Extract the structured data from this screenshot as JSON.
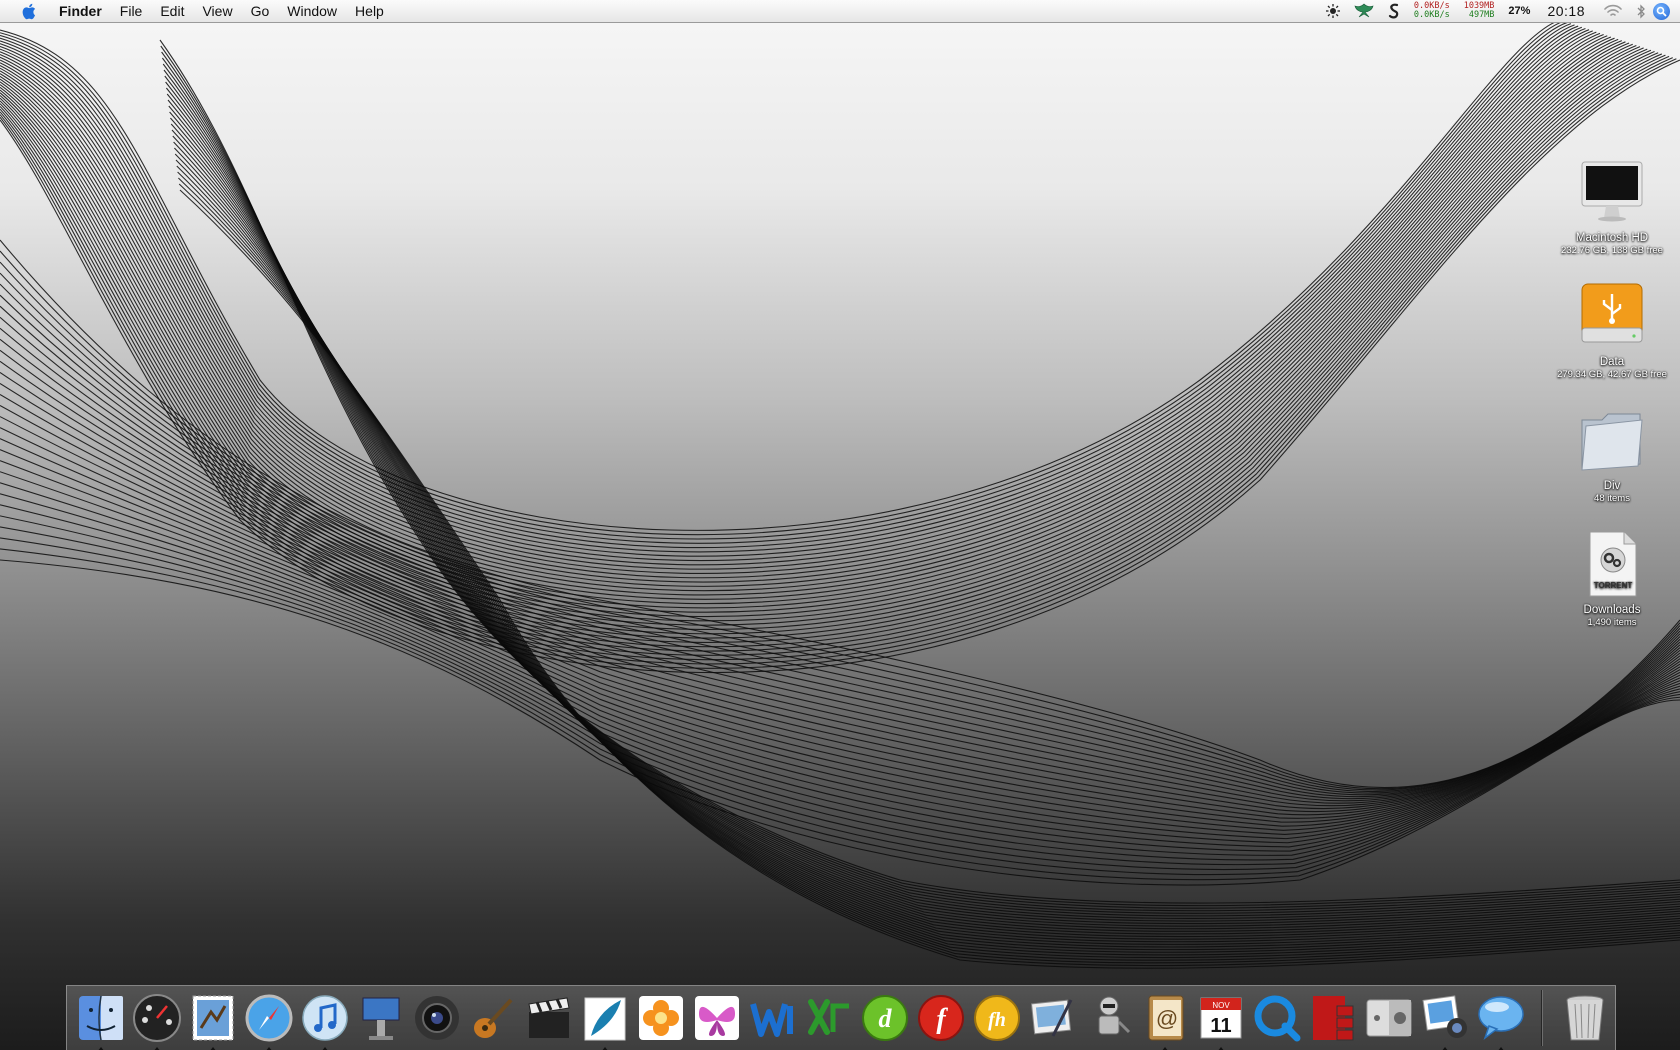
{
  "menubar": {
    "apple_icon": "apple-logo-icon",
    "app_name": "Finder",
    "menus": [
      "File",
      "Edit",
      "View",
      "Go",
      "Window",
      "Help"
    ],
    "status": {
      "brightness_icon": "brightness-icon",
      "app_status_icon": "leaf-icon",
      "dashboard_icon": "s-icon",
      "net_up": "0.0KB/s",
      "net_down": "0.0KB/s",
      "mem_used": "1039MB",
      "mem_free": "497MB",
      "cpu_percent": "27%",
      "clock": "20:18",
      "wifi_icon": "wifi-icon",
      "bluetooth_icon": "bluetooth-icon",
      "spotlight_icon": "search-icon"
    }
  },
  "desktop_icons": [
    {
      "name": "Macintosh HD",
      "info": "232.76 GB, 138 GB free",
      "icon": "imac-drive-icon"
    },
    {
      "name": "Data",
      "info": "279.34 GB, 42.67 GB free",
      "icon": "usb-drive-icon"
    },
    {
      "name": "Div",
      "info": "48 items",
      "icon": "folder-icon"
    },
    {
      "name": "Downloads",
      "info": "1,490 items",
      "icon": "torrent-file-icon"
    }
  ],
  "downloads_badge": "TORRENT",
  "calendar": {
    "month": "NOV",
    "day": "11"
  },
  "dock": {
    "items": [
      {
        "name": "finder",
        "running": true
      },
      {
        "name": "dashboard",
        "running": true
      },
      {
        "name": "mail",
        "running": true
      },
      {
        "name": "safari",
        "running": true
      },
      {
        "name": "itunes",
        "running": true
      },
      {
        "name": "keynote",
        "running": false
      },
      {
        "name": "camera",
        "running": false
      },
      {
        "name": "garageband",
        "running": false
      },
      {
        "name": "final-cut",
        "running": false
      },
      {
        "name": "feather",
        "running": true
      },
      {
        "name": "flower",
        "running": false
      },
      {
        "name": "butterfly",
        "running": false
      },
      {
        "name": "word-mac",
        "running": false
      },
      {
        "name": "excel-mac",
        "running": false
      },
      {
        "name": "dreamweaver",
        "running": false
      },
      {
        "name": "flash",
        "running": false
      },
      {
        "name": "freehand",
        "running": false
      },
      {
        "name": "preview-pen",
        "running": false
      },
      {
        "name": "automator",
        "running": false
      },
      {
        "name": "address-book",
        "running": true
      },
      {
        "name": "ical",
        "running": true
      },
      {
        "name": "quicktime",
        "running": false
      },
      {
        "name": "photo-booth",
        "running": false
      },
      {
        "name": "boot-camp",
        "running": false
      },
      {
        "name": "iphoto",
        "running": true
      },
      {
        "name": "ichat",
        "running": true
      }
    ],
    "trash": "trash-icon"
  }
}
